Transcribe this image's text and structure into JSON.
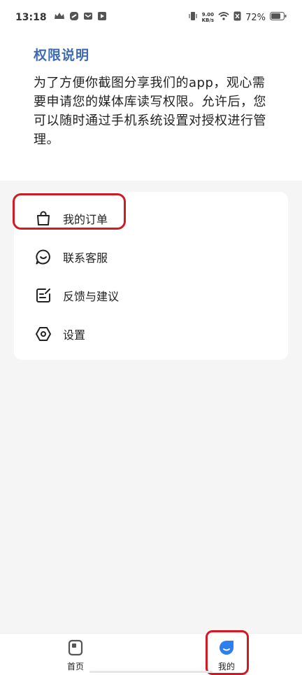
{
  "status_bar": {
    "time": "13:18",
    "net_speed_value": "9.00",
    "net_speed_unit": "KB/s",
    "battery": "72%"
  },
  "permission": {
    "title": "权限说明",
    "body": "为了方便你截图分享我们的app，观心需要申请您的媒体库读写权限。允许后，您可以随时通过手机系统设置对授权进行管理。"
  },
  "menu": {
    "items": [
      {
        "label": "我的订单",
        "icon": "shopping-bag-icon"
      },
      {
        "label": "联系客服",
        "icon": "chat-icon"
      },
      {
        "label": "反馈与建议",
        "icon": "edit-feedback-icon"
      },
      {
        "label": "设置",
        "icon": "hexagon-settings-icon"
      }
    ]
  },
  "tabs": {
    "home": "首页",
    "mine": "我的"
  },
  "colors": {
    "accent": "#3d6bb5",
    "mine_tab": "#2d7ff0",
    "highlight": "#d11b24"
  }
}
